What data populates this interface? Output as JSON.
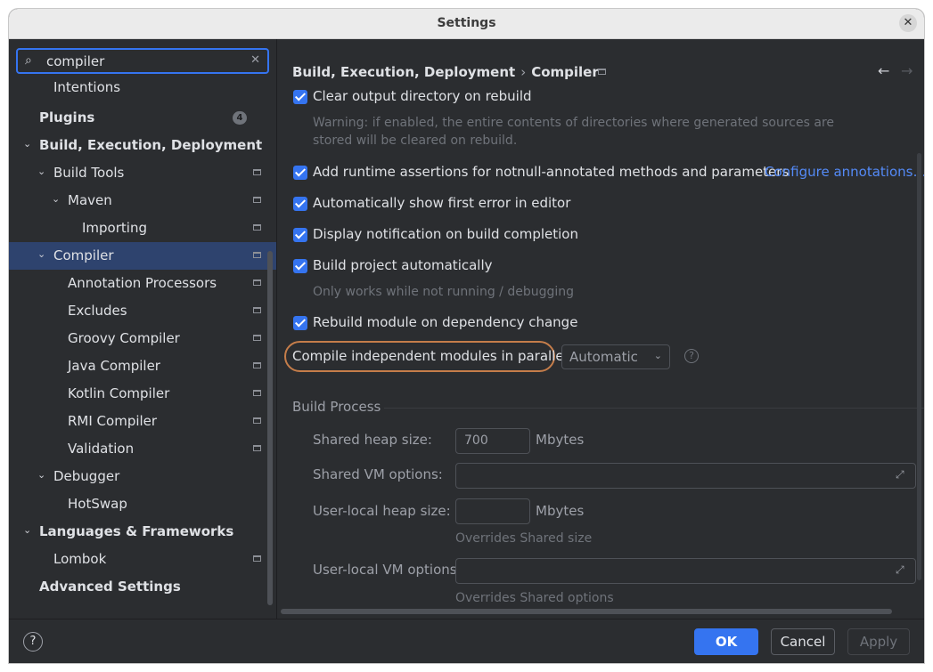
{
  "window": {
    "title": "Settings"
  },
  "search": {
    "value": "compiler"
  },
  "tree": [
    {
      "label": "Intentions"
    },
    {
      "label": "Plugins",
      "badge": "4"
    },
    {
      "label": "Build, Execution, Deployment"
    },
    {
      "label": "Build Tools"
    },
    {
      "label": "Maven"
    },
    {
      "label": "Importing"
    },
    {
      "label": "Compiler",
      "selected": true
    },
    {
      "label": "Annotation Processors"
    },
    {
      "label": "Excludes"
    },
    {
      "label": "Groovy Compiler"
    },
    {
      "label": "Java Compiler"
    },
    {
      "label": "Kotlin Compiler"
    },
    {
      "label": "RMI Compiler"
    },
    {
      "label": "Validation"
    },
    {
      "label": "Debugger"
    },
    {
      "label": "HotSwap"
    },
    {
      "label": "Languages & Frameworks"
    },
    {
      "label": "Lombok"
    },
    {
      "label": "Advanced Settings"
    }
  ],
  "breadcrumb": {
    "parent": "Build, Execution, Deployment",
    "current": "Compiler"
  },
  "options": {
    "clear_output": "Clear output directory on rebuild",
    "clear_output_hint_1": "Warning: if enabled, the entire contents of directories where generated sources are",
    "clear_output_hint_2": "stored will be cleared on rebuild.",
    "runtime_assertions": "Add runtime assertions for notnull-annotated methods and parameters",
    "configure_annotations": "Configure annotations…",
    "show_first_error": "Automatically show first error in editor",
    "notify_build": "Display notification on build completion",
    "build_auto": "Build project automatically",
    "build_auto_hint": "Only works while not running / debugging",
    "rebuild_module": "Rebuild module on dependency change"
  },
  "parallel": {
    "label": "Compile independent modules in parallel:",
    "value": "Automatic"
  },
  "build_process": {
    "title": "Build Process",
    "shared_heap_label": "Shared heap size:",
    "shared_heap_value": "700",
    "shared_heap_unit": "Mbytes",
    "shared_vm_label": "Shared VM options:",
    "user_heap_label": "User-local heap size:",
    "user_heap_unit": "Mbytes",
    "user_heap_hint": "Overrides Shared size",
    "user_vm_label": "User-local VM options:",
    "user_vm_hint": "Overrides Shared options"
  },
  "footer": {
    "ok": "OK",
    "cancel": "Cancel",
    "apply": "Apply"
  },
  "colors": {
    "accent": "#3574f0",
    "highlight": "#c57d4a",
    "selection": "#2e436e"
  }
}
